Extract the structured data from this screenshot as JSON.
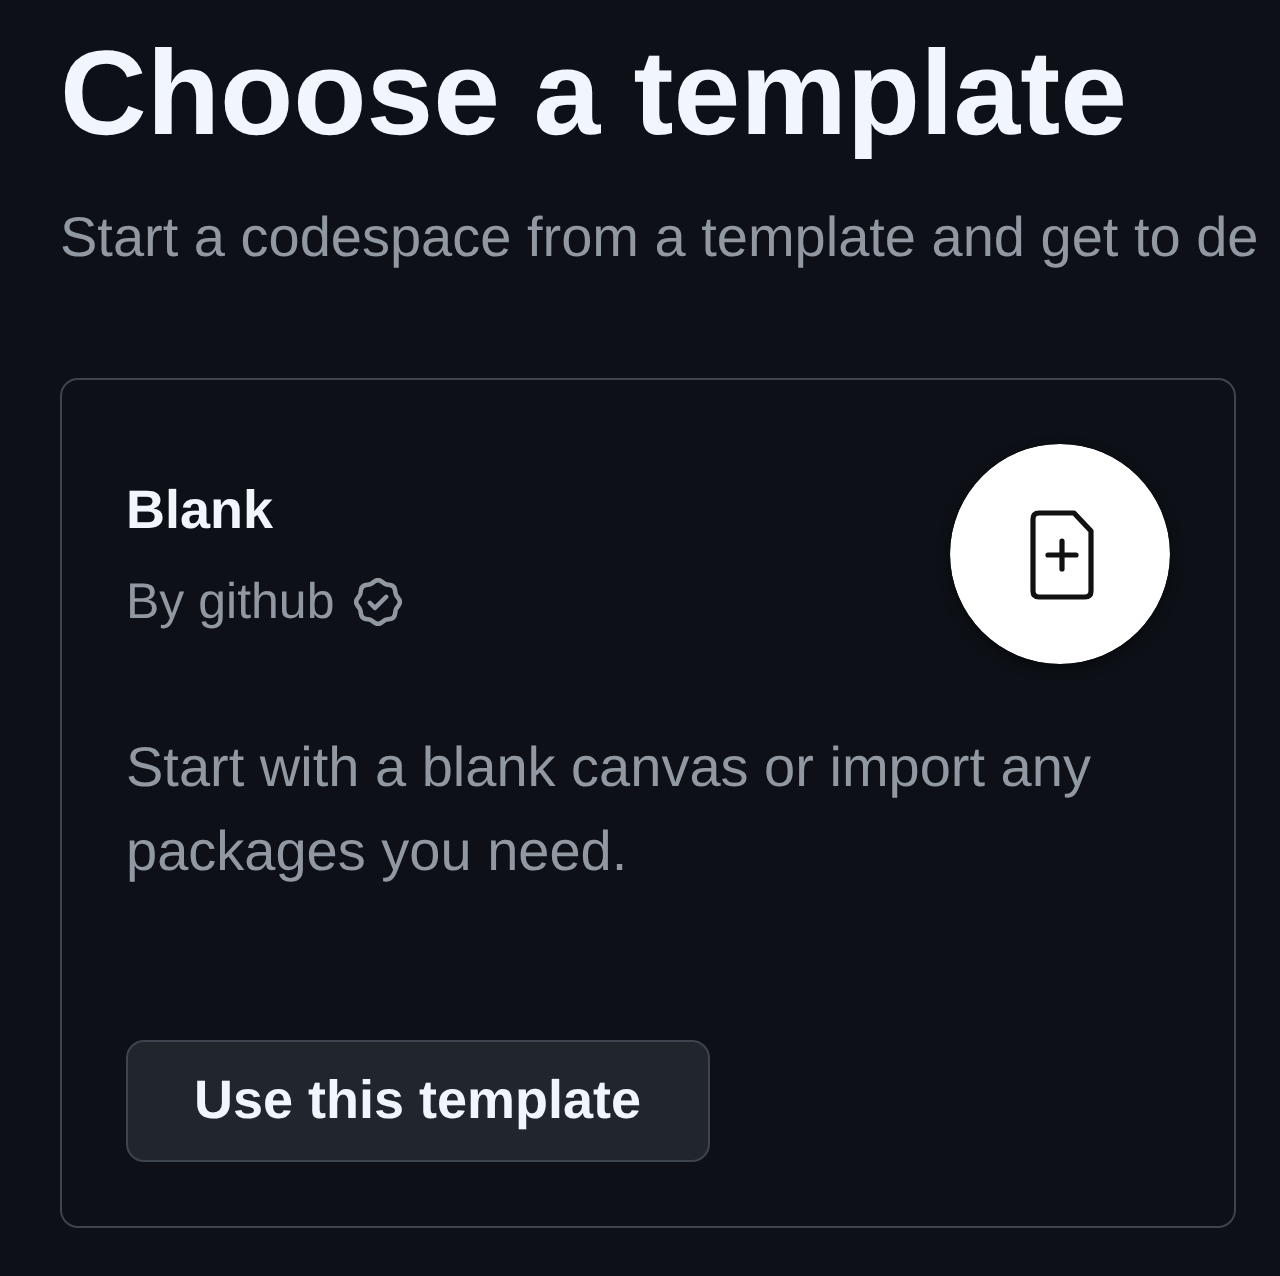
{
  "page": {
    "title": "Choose a template",
    "subtitle": "Start a codespace from a template and get to de"
  },
  "template_card": {
    "name": "Blank",
    "author": "By github",
    "verified": true,
    "description": "Start with a blank canvas or import any packages you need.",
    "button": "Use this template"
  }
}
